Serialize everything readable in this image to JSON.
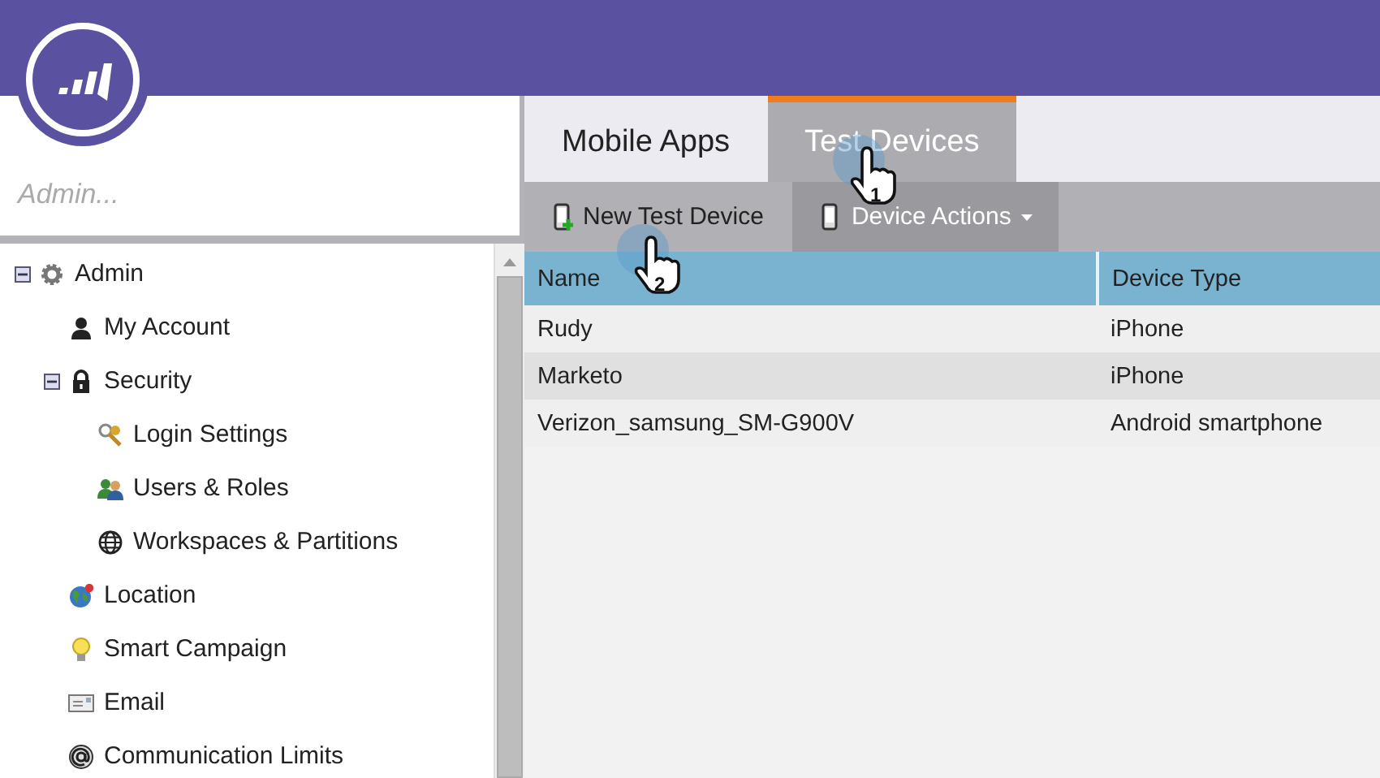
{
  "search": {
    "placeholder": "Admin..."
  },
  "tree": [
    {
      "label": "Admin",
      "expanded": true,
      "children": [
        {
          "label": "My Account"
        },
        {
          "label": "Security",
          "expanded": true,
          "children": [
            {
              "label": "Login Settings"
            },
            {
              "label": "Users & Roles"
            },
            {
              "label": "Workspaces & Partitions"
            }
          ]
        },
        {
          "label": "Location"
        },
        {
          "label": "Smart Campaign"
        },
        {
          "label": "Email"
        },
        {
          "label": "Communication Limits"
        }
      ]
    }
  ],
  "tabs": [
    {
      "label": "Mobile Apps",
      "selected": false
    },
    {
      "label": "Test Devices",
      "selected": true
    }
  ],
  "toolbar": [
    {
      "label": "New Test Device",
      "kind": "add"
    },
    {
      "label": "Device Actions",
      "kind": "menu"
    }
  ],
  "table": {
    "columns": [
      "Name",
      "Device Type"
    ],
    "rows": [
      [
        "Rudy",
        "iPhone"
      ],
      [
        "Marketo",
        "iPhone"
      ],
      [
        "Verizon_samsung_SM-G900V",
        "Android smartphone"
      ]
    ]
  },
  "callouts": [
    {
      "number": "1"
    },
    {
      "number": "2"
    }
  ]
}
